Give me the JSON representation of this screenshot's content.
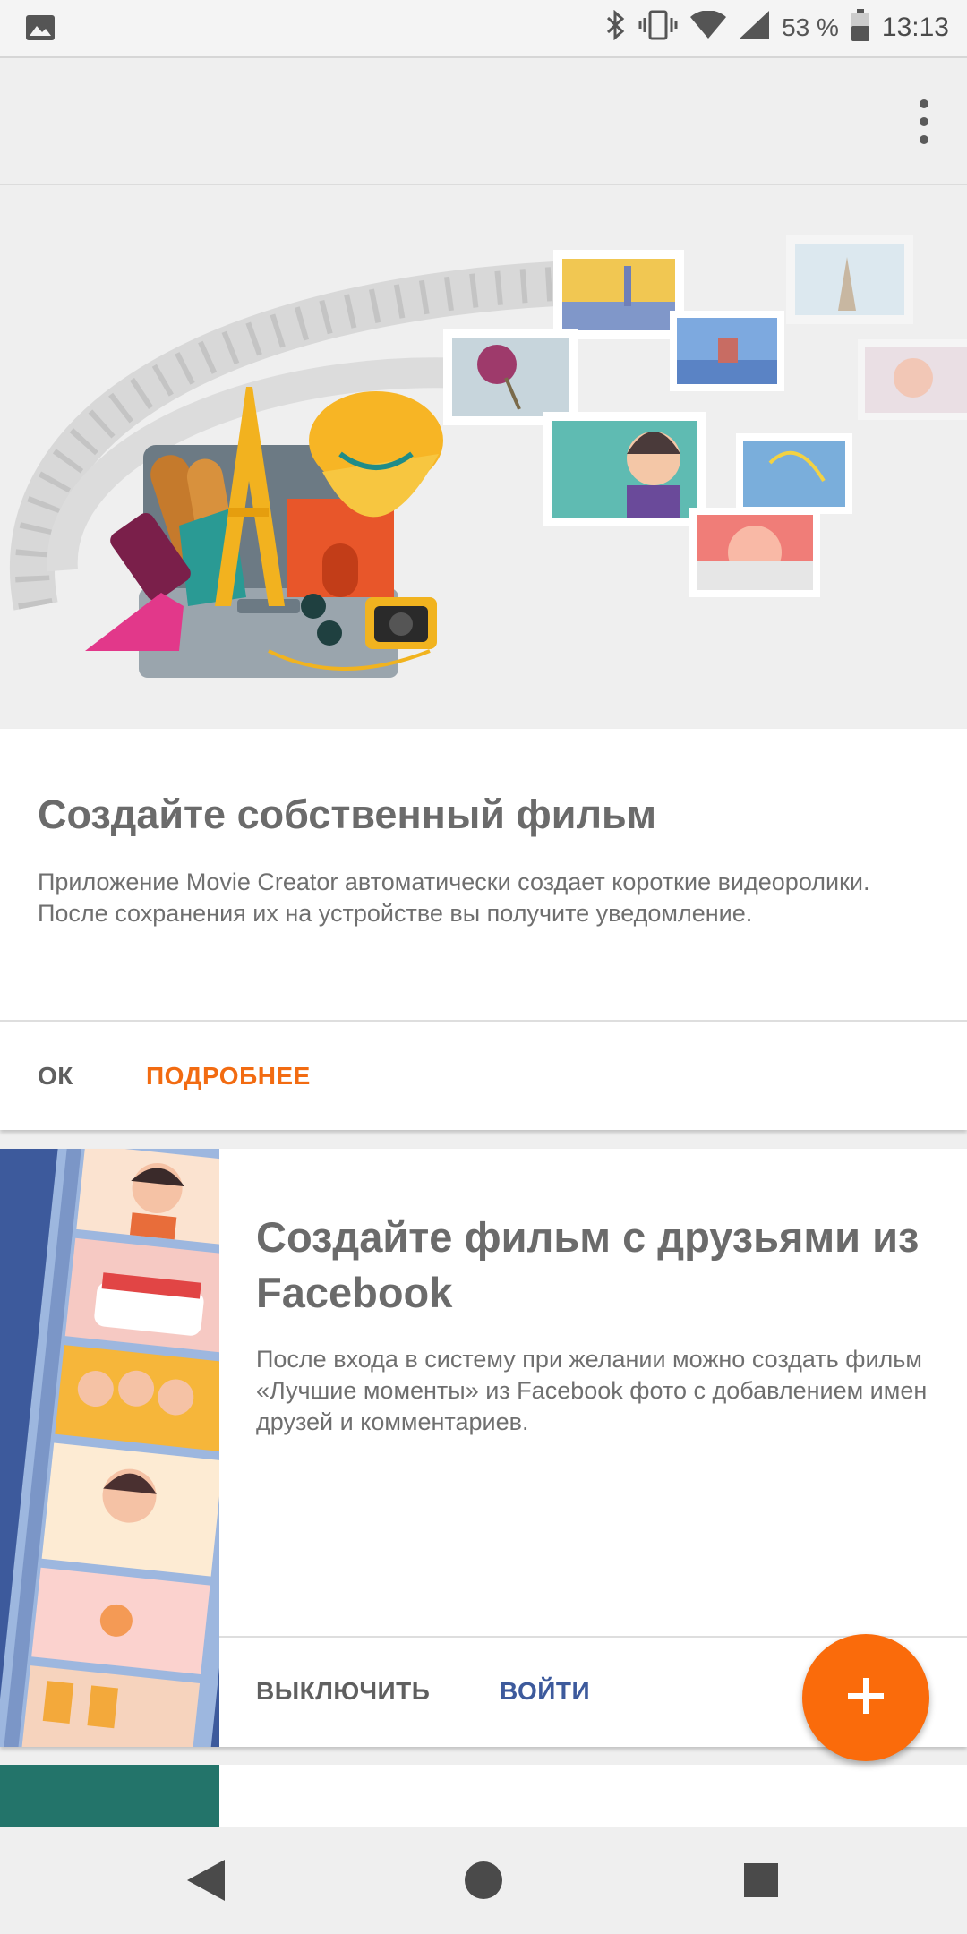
{
  "status_bar": {
    "battery": "53 %",
    "time": "13:13",
    "icons": [
      "image-notification-icon",
      "bluetooth-icon",
      "vibrate-icon",
      "wifi-icon",
      "signal-icon",
      "battery-icon"
    ]
  },
  "toolbar": {
    "menu_icon": "overflow-menu-icon"
  },
  "card1": {
    "title": "Создайте собственный фильм",
    "body": "Приложение Movie Creator автоматически создает короткие видеоролики. После сохранения их на устройстве вы получите уведомление.",
    "ok_label": "ОК",
    "more_label": "ПОДРОБНЕЕ"
  },
  "card2": {
    "title": "Создайте фильм с друзьями из Facebook",
    "body": "После входа в систему при желании можно создать фильм «Лучшие моменты» из Facebook фото с добавлением имен друзей и комментариев.",
    "disable_label": "ВЫКЛЮЧИТЬ",
    "login_label": "ВОЙТИ"
  },
  "fab": {
    "icon": "plus-icon"
  },
  "navbar": {
    "icons": [
      "back-icon",
      "home-icon",
      "recents-icon"
    ]
  },
  "colors": {
    "accent": "#fa6b0b",
    "facebook_blue": "#3d5a9c",
    "text": "#6b6b6b"
  }
}
